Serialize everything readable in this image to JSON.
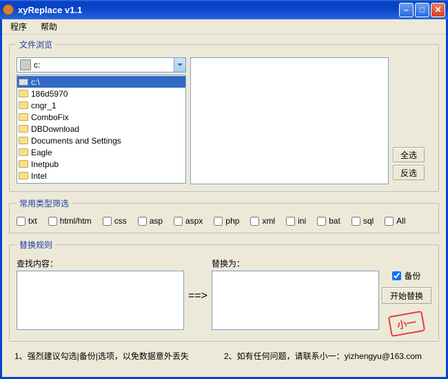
{
  "window": {
    "title": "xyReplace v1.1"
  },
  "menu": {
    "program": "程序",
    "help": "帮助"
  },
  "browse": {
    "legend": "文件浏览",
    "drive": "c:",
    "folders": [
      {
        "name": "c:\\",
        "type": "drive",
        "selected": true
      },
      {
        "name": "186d5970",
        "type": "folder"
      },
      {
        "name": "cngr_1",
        "type": "folder"
      },
      {
        "name": "ComboFix",
        "type": "folder"
      },
      {
        "name": "DBDownload",
        "type": "folder"
      },
      {
        "name": "Documents and Settings",
        "type": "folder"
      },
      {
        "name": "Eagle",
        "type": "folder"
      },
      {
        "name": "Inetpub",
        "type": "folder"
      },
      {
        "name": "Intel",
        "type": "folder"
      }
    ],
    "select_all": "全选",
    "invert": "反选"
  },
  "types": {
    "legend": "常用类型筛选",
    "items": [
      "txt",
      "html/htm",
      "css",
      "asp",
      "aspx",
      "php",
      "xml",
      "ini",
      "bat",
      "sql",
      "All"
    ]
  },
  "replace": {
    "legend": "替换规则",
    "find_label": "查找内容：",
    "replace_label": "替换为：",
    "arrow": "==>",
    "backup_label": "备份",
    "backup_checked": true,
    "start_label": "开始替换",
    "stamp": "小一"
  },
  "footer": {
    "note1": "1、强烈建议勾选|备份|选项，以免数据意外丢失",
    "note2": "2、如有任何问题，请联系小一：yizhengyu@163.com"
  }
}
